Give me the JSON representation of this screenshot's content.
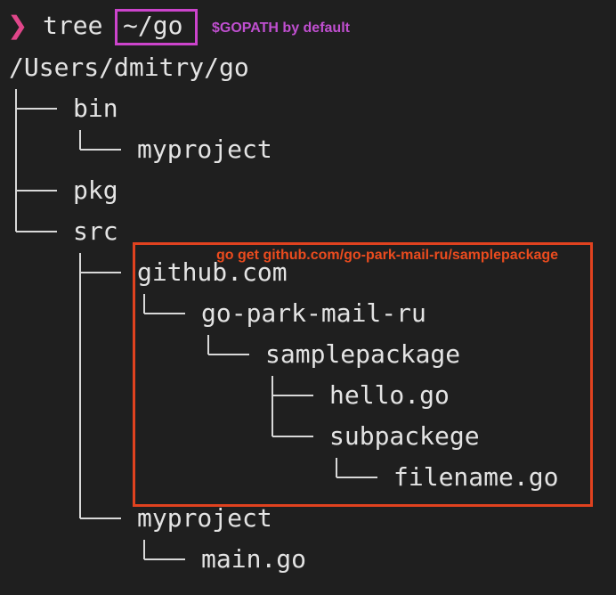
{
  "terminal": {
    "prompt_symbol": "❯",
    "command": "tree",
    "argument": "~/go",
    "argument_note": "$GOPATH by default",
    "root_path": "/Users/dmitry/go"
  },
  "tree": {
    "bin": "bin",
    "bin_myproject": "myproject",
    "pkg": "pkg",
    "src": "src",
    "github": "github.com",
    "org": "go-park-mail-ru",
    "samplepackage": "samplepackage",
    "hello": "hello.go",
    "subpackege": "subpackege",
    "filename": "filename.go",
    "src_myproject": "myproject",
    "main": "main.go"
  },
  "annotations": {
    "go_get_note": "go get github.com/go-park-mail-ru/samplepackage",
    "highlight_color": "#e0421f",
    "argument_box_color": "#cc44cc"
  }
}
